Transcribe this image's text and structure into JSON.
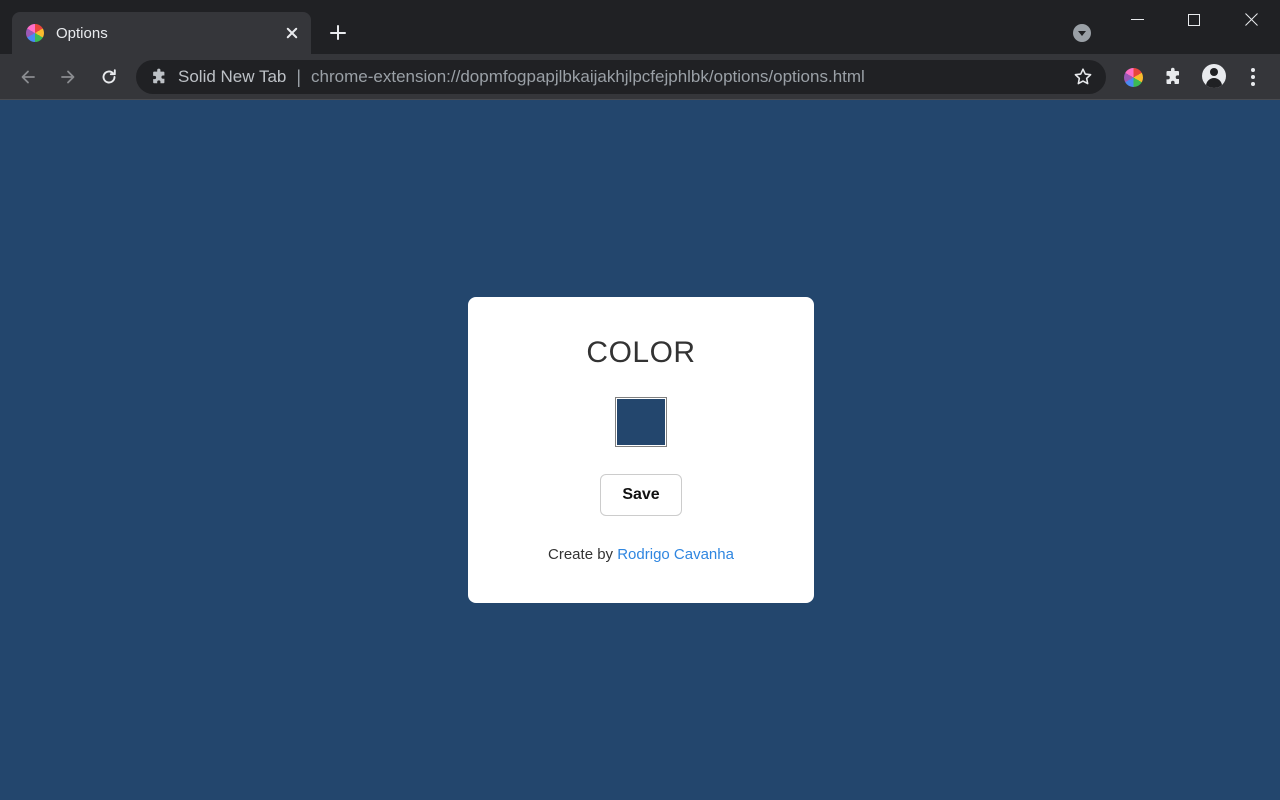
{
  "browser": {
    "tab": {
      "title": "Options"
    },
    "omnibox": {
      "extension_name": "Solid New Tab",
      "separator": "|",
      "url": "chrome-extension://dopmfogpapjlbkaijakhjlpcfejphlbk/options/options.html"
    },
    "icons": {
      "tab_favicon": "color-wheel-icon",
      "new_tab": "plus-icon",
      "tab_search": "chevron-down-circle-icon",
      "back": "back-arrow-icon",
      "forward": "forward-arrow-icon",
      "reload": "reload-icon",
      "extension_puzzle": "puzzle-icon",
      "bookmark": "star-icon",
      "extension_color": "color-wheel-icon",
      "extensions_menu": "puzzle-icon",
      "profile": "avatar-icon",
      "menu": "kebab-menu-icon"
    }
  },
  "page": {
    "background_color": "#23466D",
    "card": {
      "title": "COLOR",
      "selected_color": "#23466D",
      "save_label": "Save",
      "credit_prefix": "Create by ",
      "credit_author": "Rodrigo Cavanha"
    },
    "link_color": "#2F86E0"
  }
}
